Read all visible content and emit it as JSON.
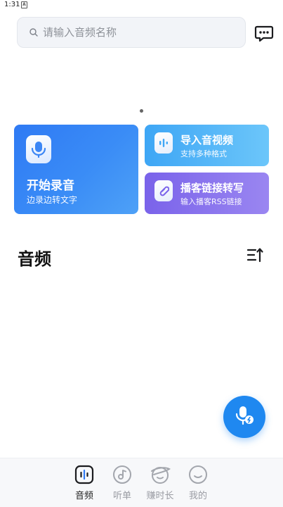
{
  "status_bar": {
    "time": "1:31",
    "notification_glyph": "A"
  },
  "search": {
    "placeholder": "请输入音频名称",
    "value": ""
  },
  "header": {
    "message_icon": "message-dots-icon"
  },
  "cards": {
    "record": {
      "title": "开始录音",
      "subtitle": "边录边转文字",
      "icon": "microphone-icon"
    },
    "import": {
      "title": "导入音视频",
      "subtitle": "支持多种格式",
      "icon": "waveform-icon"
    },
    "podcast": {
      "title": "播客链接转写",
      "subtitle": "输入播客RSS链接",
      "icon": "link-icon"
    }
  },
  "section": {
    "title": "音频",
    "sort_icon": "sort-icon"
  },
  "fab": {
    "icon": "microphone-add-icon"
  },
  "bottom_nav": {
    "items": [
      {
        "label": "音频",
        "icon": "audio-icon",
        "active": true
      },
      {
        "label": "听单",
        "icon": "music-disc-icon",
        "active": false
      },
      {
        "label": "赚时长",
        "icon": "earn-time-icon",
        "active": false
      },
      {
        "label": "我的",
        "icon": "profile-face-icon",
        "active": false
      }
    ]
  },
  "colors": {
    "primary": "#1f88f0",
    "record_card": "#2f7af4",
    "import_card": "#3ea6f5",
    "podcast_card": "#7a63ea"
  }
}
